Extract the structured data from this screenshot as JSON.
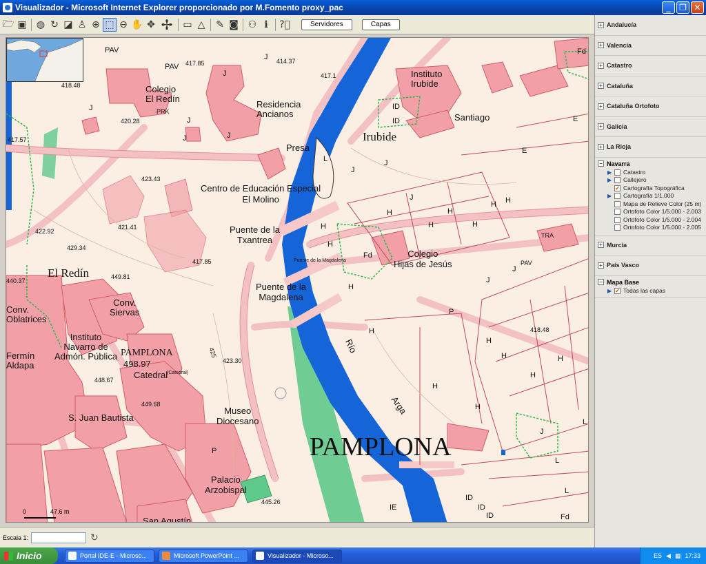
{
  "window": {
    "title": "Visualizador - Microsoft Internet Explorer proporcionado por M.Fomento proxy_pac"
  },
  "toolbar": {
    "tools": [
      "folder-icon",
      "save-icon",
      "globe-icon",
      "refresh-icon",
      "layers-icon",
      "user-icon",
      "zoom-in-icon",
      "zoom-box-icon",
      "zoom-out-icon",
      "pan-hand-icon",
      "move-icon",
      "pan-arrows-icon",
      "ruler-icon",
      "area-icon",
      "print-icon",
      "camera-icon",
      "binoculars-icon",
      "info-icon",
      "help-icon"
    ],
    "servidores_label": "Servidores",
    "capas_label": "Capas"
  },
  "map": {
    "labels": {
      "pav1": "PAV",
      "pav2": "PAV",
      "v417_85": "417.85",
      "v414_37": "414.37",
      "j1": "J",
      "j2": "J",
      "v417_1": "417.1",
      "colegio_redin": "Colegio\nEl Redín",
      "residencia": "Residencia\nAncianos",
      "instituto_irubide": "Instituto\nIrubide",
      "id1": "ID",
      "id2": "ID",
      "santiago": "Santiago",
      "e1": "E",
      "e2": "E",
      "fd1": "Fd",
      "v418_48": "418.48",
      "j3": "J",
      "prk": "PRK",
      "v420_28": "420.28",
      "j4": "J",
      "j5": "J",
      "j6": "J",
      "v417_57": "417.57",
      "presa": "Presa",
      "l1": "L",
      "irubide": "Irubide",
      "j7": "J",
      "j8": "J",
      "j9": "J",
      "v423_43": "423.43",
      "centro_educacion": "Centro de Educación Especial\nEl Molino",
      "h1": "H",
      "h2": "H",
      "h3": "H",
      "h4": "H",
      "h5": "H",
      "h6": "H",
      "v422_92": "422.92",
      "v421_41": "421.41",
      "puente_txantrea": "Puente de la\nTxantrea",
      "h7": "H",
      "h8": "H",
      "v429_34": "429.34",
      "fd2": "Fd",
      "colegio_hijas": "Colegio\nHijas de Jesús",
      "tra": "TRA",
      "pav3": "PAV",
      "v417_85b": "417.85",
      "puente_magdalena_small": "Puente de la Magdalena",
      "j10": "J",
      "j11": "J",
      "el_redin": "El Redín",
      "v449_81": "449.81",
      "v440_37": "440.37",
      "puente_magdalena": "Puente de la\nMagdalena",
      "conv_siervas": "Conv.\nSiervas",
      "conv_oblatrices": "Conv.\nOblatrices",
      "p1": "P",
      "h9": "H",
      "rio": "Río",
      "instituto_navarro": "Instituto\nNavarro de\nAdmón. Pública",
      "pamplona_small": "PAMPLONA",
      "v498_97": "498.97",
      "catedral": "Catedral",
      "catedral_small": "(Catedral)",
      "v425": "425",
      "v423_30": "423.30",
      "fermin_aldapa": "Fermín\nAldapa",
      "v418_48b": "418.48",
      "h10": "H",
      "h11": "H",
      "h12": "H",
      "h13": "H",
      "v448_67": "448.67",
      "v449_68": "449.68",
      "arga": "Arga",
      "s_juan_bautista": "S. Juan Bautista",
      "museo_diocesano": "Museo\nDiocesano",
      "pamplona_big": "PAMPLONA",
      "j12": "J",
      "l2": "L",
      "l3": "L",
      "l4": "L",
      "p2": "P",
      "palacio_arzobispal": "Palacio\nArzobispal",
      "v445_26": "445.26",
      "ie": "IE",
      "id3": "ID",
      "id4": "ID",
      "id5": "ID",
      "san_agustin": "San Agustín",
      "fd3": "Fd",
      "h14": "H",
      "h15": "H",
      "h16": "H"
    },
    "scale_label": "47.6 m"
  },
  "bottombar": {
    "scale_label": "Escala 1:",
    "scale_value": ""
  },
  "panel": {
    "groups": [
      {
        "label": "Andalucía",
        "sign": "+"
      },
      {
        "label": "Valencia",
        "sign": "+"
      },
      {
        "label": "Catastro",
        "sign": "+"
      },
      {
        "label": "Cataluña",
        "sign": "+"
      },
      {
        "label": "Cataluña Ortofoto",
        "sign": "+"
      },
      {
        "label": "Galicia",
        "sign": "+"
      },
      {
        "label": "La Rioja",
        "sign": "+"
      }
    ],
    "navarra": {
      "label": "Navarra",
      "sign": "−",
      "items": [
        {
          "label": "Catastro",
          "checked": "",
          "arrow": "▶"
        },
        {
          "label": "Callejero",
          "checked": "",
          "arrow": "▶"
        },
        {
          "label": "Cartografía Topográfica",
          "checked": "✔",
          "arrow": ""
        },
        {
          "label": "Cartografía 1/1.000",
          "checked": "",
          "arrow": "▶"
        },
        {
          "label": "Mapa de Relieve Color (25 m)",
          "checked": "",
          "arrow": ""
        },
        {
          "label": "Ortofoto Color 1/5.000 - 2.003",
          "checked": "",
          "arrow": ""
        },
        {
          "label": "Ortofoto Color 1/5.000 - 2.004",
          "checked": "",
          "arrow": ""
        },
        {
          "label": "Ortofoto Color 1/5.000 - 2.005",
          "checked": "",
          "arrow": ""
        }
      ]
    },
    "groups2": [
      {
        "label": "Murcia",
        "sign": "+"
      },
      {
        "label": "País Vasco",
        "sign": "+"
      }
    ],
    "mapabase": {
      "label": "Mapa Base",
      "sign": "−",
      "item": {
        "label": "Todas las capas",
        "checked": "✔",
        "arrow": "▶"
      }
    }
  },
  "taskbar": {
    "start_label": "Inicio",
    "tasks": [
      "Portal IDE-E - Microso...",
      "Microsoft PowerPoint ...",
      "Visualizador - Microso..."
    ],
    "lang": "ES",
    "clock": "17:33"
  },
  "colors": {
    "river": "#1565d8",
    "building": "#f2a0a8",
    "road": "#f6c8c8",
    "green": "#5fc98a",
    "background": "#fbefe4"
  }
}
